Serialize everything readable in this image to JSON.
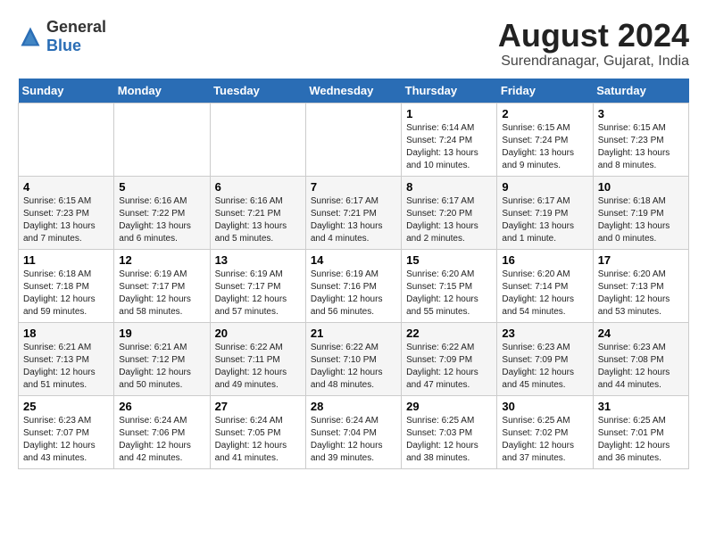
{
  "logo": {
    "general": "General",
    "blue": "Blue"
  },
  "title": {
    "month_year": "August 2024",
    "location": "Surendranagar, Gujarat, India"
  },
  "days_of_week": [
    "Sunday",
    "Monday",
    "Tuesday",
    "Wednesday",
    "Thursday",
    "Friday",
    "Saturday"
  ],
  "weeks": [
    [
      {
        "day": "",
        "text": ""
      },
      {
        "day": "",
        "text": ""
      },
      {
        "day": "",
        "text": ""
      },
      {
        "day": "",
        "text": ""
      },
      {
        "day": "1",
        "text": "Sunrise: 6:14 AM\nSunset: 7:24 PM\nDaylight: 13 hours\nand 10 minutes."
      },
      {
        "day": "2",
        "text": "Sunrise: 6:15 AM\nSunset: 7:24 PM\nDaylight: 13 hours\nand 9 minutes."
      },
      {
        "day": "3",
        "text": "Sunrise: 6:15 AM\nSunset: 7:23 PM\nDaylight: 13 hours\nand 8 minutes."
      }
    ],
    [
      {
        "day": "4",
        "text": "Sunrise: 6:15 AM\nSunset: 7:23 PM\nDaylight: 13 hours\nand 7 minutes."
      },
      {
        "day": "5",
        "text": "Sunrise: 6:16 AM\nSunset: 7:22 PM\nDaylight: 13 hours\nand 6 minutes."
      },
      {
        "day": "6",
        "text": "Sunrise: 6:16 AM\nSunset: 7:21 PM\nDaylight: 13 hours\nand 5 minutes."
      },
      {
        "day": "7",
        "text": "Sunrise: 6:17 AM\nSunset: 7:21 PM\nDaylight: 13 hours\nand 4 minutes."
      },
      {
        "day": "8",
        "text": "Sunrise: 6:17 AM\nSunset: 7:20 PM\nDaylight: 13 hours\nand 2 minutes."
      },
      {
        "day": "9",
        "text": "Sunrise: 6:17 AM\nSunset: 7:19 PM\nDaylight: 13 hours\nand 1 minute."
      },
      {
        "day": "10",
        "text": "Sunrise: 6:18 AM\nSunset: 7:19 PM\nDaylight: 13 hours\nand 0 minutes."
      }
    ],
    [
      {
        "day": "11",
        "text": "Sunrise: 6:18 AM\nSunset: 7:18 PM\nDaylight: 12 hours\nand 59 minutes."
      },
      {
        "day": "12",
        "text": "Sunrise: 6:19 AM\nSunset: 7:17 PM\nDaylight: 12 hours\nand 58 minutes."
      },
      {
        "day": "13",
        "text": "Sunrise: 6:19 AM\nSunset: 7:17 PM\nDaylight: 12 hours\nand 57 minutes."
      },
      {
        "day": "14",
        "text": "Sunrise: 6:19 AM\nSunset: 7:16 PM\nDaylight: 12 hours\nand 56 minutes."
      },
      {
        "day": "15",
        "text": "Sunrise: 6:20 AM\nSunset: 7:15 PM\nDaylight: 12 hours\nand 55 minutes."
      },
      {
        "day": "16",
        "text": "Sunrise: 6:20 AM\nSunset: 7:14 PM\nDaylight: 12 hours\nand 54 minutes."
      },
      {
        "day": "17",
        "text": "Sunrise: 6:20 AM\nSunset: 7:13 PM\nDaylight: 12 hours\nand 53 minutes."
      }
    ],
    [
      {
        "day": "18",
        "text": "Sunrise: 6:21 AM\nSunset: 7:13 PM\nDaylight: 12 hours\nand 51 minutes."
      },
      {
        "day": "19",
        "text": "Sunrise: 6:21 AM\nSunset: 7:12 PM\nDaylight: 12 hours\nand 50 minutes."
      },
      {
        "day": "20",
        "text": "Sunrise: 6:22 AM\nSunset: 7:11 PM\nDaylight: 12 hours\nand 49 minutes."
      },
      {
        "day": "21",
        "text": "Sunrise: 6:22 AM\nSunset: 7:10 PM\nDaylight: 12 hours\nand 48 minutes."
      },
      {
        "day": "22",
        "text": "Sunrise: 6:22 AM\nSunset: 7:09 PM\nDaylight: 12 hours\nand 47 minutes."
      },
      {
        "day": "23",
        "text": "Sunrise: 6:23 AM\nSunset: 7:09 PM\nDaylight: 12 hours\nand 45 minutes."
      },
      {
        "day": "24",
        "text": "Sunrise: 6:23 AM\nSunset: 7:08 PM\nDaylight: 12 hours\nand 44 minutes."
      }
    ],
    [
      {
        "day": "25",
        "text": "Sunrise: 6:23 AM\nSunset: 7:07 PM\nDaylight: 12 hours\nand 43 minutes."
      },
      {
        "day": "26",
        "text": "Sunrise: 6:24 AM\nSunset: 7:06 PM\nDaylight: 12 hours\nand 42 minutes."
      },
      {
        "day": "27",
        "text": "Sunrise: 6:24 AM\nSunset: 7:05 PM\nDaylight: 12 hours\nand 41 minutes."
      },
      {
        "day": "28",
        "text": "Sunrise: 6:24 AM\nSunset: 7:04 PM\nDaylight: 12 hours\nand 39 minutes."
      },
      {
        "day": "29",
        "text": "Sunrise: 6:25 AM\nSunset: 7:03 PM\nDaylight: 12 hours\nand 38 minutes."
      },
      {
        "day": "30",
        "text": "Sunrise: 6:25 AM\nSunset: 7:02 PM\nDaylight: 12 hours\nand 37 minutes."
      },
      {
        "day": "31",
        "text": "Sunrise: 6:25 AM\nSunset: 7:01 PM\nDaylight: 12 hours\nand 36 minutes."
      }
    ]
  ]
}
